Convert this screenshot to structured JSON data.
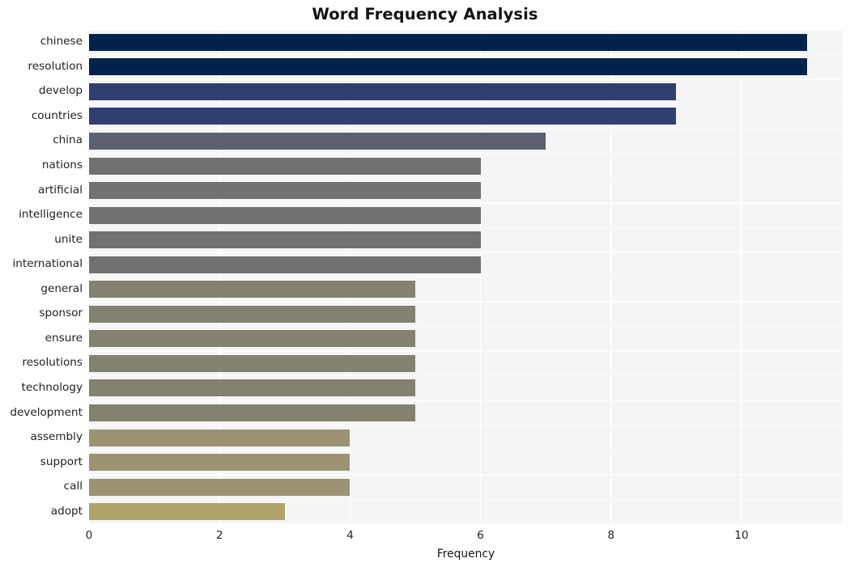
{
  "chart_data": {
    "type": "bar",
    "orientation": "horizontal",
    "title": "Word Frequency Analysis",
    "xlabel": "Frequency",
    "ylabel": "",
    "categories": [
      "chinese",
      "resolution",
      "develop",
      "countries",
      "china",
      "nations",
      "artificial",
      "intelligence",
      "unite",
      "international",
      "general",
      "sponsor",
      "ensure",
      "resolutions",
      "technology",
      "development",
      "assembly",
      "support",
      "call",
      "adopt"
    ],
    "values": [
      11,
      11,
      9,
      9,
      7,
      6,
      6,
      6,
      6,
      6,
      5,
      5,
      5,
      5,
      5,
      5,
      4,
      4,
      4,
      3
    ],
    "bar_colors": [
      "#00234c",
      "#00234c",
      "#2f4070",
      "#2f4070",
      "#5c6070",
      "#717171",
      "#717171",
      "#717171",
      "#717171",
      "#717171",
      "#83816f",
      "#83816f",
      "#83816f",
      "#83816f",
      "#83816f",
      "#83816f",
      "#9c9373",
      "#9c9373",
      "#9c9373",
      "#b0a568"
    ],
    "xlim": [
      0,
      11.55
    ],
    "xticks": [
      0,
      2,
      4,
      6,
      8,
      10
    ],
    "xtick_labels": [
      "0",
      "2",
      "4",
      "6",
      "8",
      "10"
    ],
    "grid": true,
    "legend": "none",
    "plot_background": "#f5f5f6",
    "figure_background": "#ffffff",
    "gridline_color": "#ffffff"
  }
}
